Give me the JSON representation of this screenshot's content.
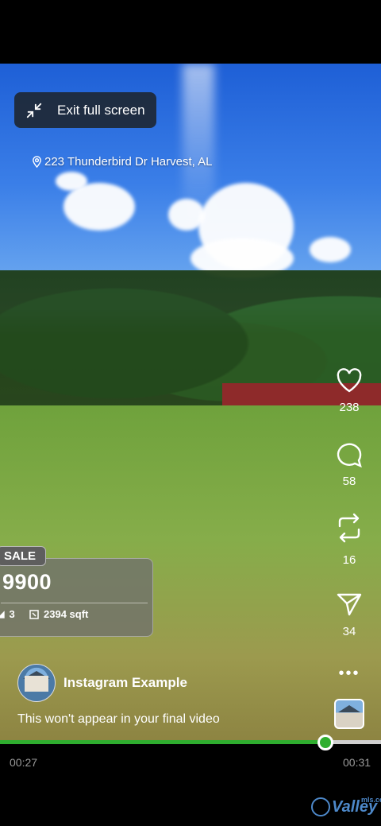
{
  "overlay": {
    "exit_fullscreen_label": "Exit full screen",
    "address": "223 Thunderbird Dr Harvest, AL"
  },
  "listing": {
    "badge": "SALE",
    "price": "9900",
    "beds": "3",
    "sqft": "2394 sqft"
  },
  "actions": {
    "likes": "238",
    "comments": "58",
    "reposts": "16",
    "shares": "34"
  },
  "post": {
    "account_name": "Instagram Example",
    "caption": "This won't appear in your final video"
  },
  "playback": {
    "current_time": "00:27",
    "total_time": "00:31",
    "progress": 0.855
  },
  "watermark": {
    "brand": "Valley",
    "suffix": "mls.com"
  },
  "colors": {
    "progress": "#2fae2f",
    "watermark": "#4d88c9"
  }
}
